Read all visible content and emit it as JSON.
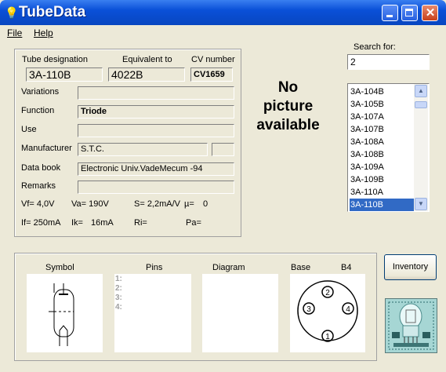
{
  "window": {
    "title": "TubeData",
    "icon": "lightbulb-icon"
  },
  "menu": {
    "file": "File",
    "help": "Help"
  },
  "header": {
    "tube_designation_label": "Tube designation",
    "tube_designation_value": "3A-110B",
    "equivalent_label": "Equivalent to",
    "equivalent_value": "4022B",
    "cv_label": "CV number",
    "cv_value": "CV1659"
  },
  "fields": {
    "variations_label": "Variations",
    "variations_value": "",
    "function_label": "Function",
    "function_value": "Triode",
    "use_label": "Use",
    "use_value": "",
    "manufacturer_label": "Manufacturer",
    "manufacturer_value": "S.T.C.",
    "manufacturer_code": "",
    "databook_label": "Data book",
    "databook_value": "Electronic Univ.VadeMecum -94",
    "remarks_label": "Remarks",
    "remarks_value": ""
  },
  "specs": {
    "vf": "Vf= 4,0V",
    "va": "Va= 190V",
    "s": "S= 2,2mA/V",
    "mu": "µ=",
    "mu_value": "0",
    "if": "If= 250mA",
    "ik": "Ik=",
    "ik_value": "16mA",
    "ri": "Ri=",
    "pa": "Pa="
  },
  "picture": {
    "line1": "No",
    "line2": "picture",
    "line3": "available"
  },
  "search": {
    "label": "Search for:",
    "value": "2"
  },
  "tube_list": {
    "items": [
      "3A-104B",
      "3A-105B",
      "3A-107A",
      "3A-107B",
      "3A-108A",
      "3A-108B",
      "3A-109A",
      "3A-109B",
      "3A-110A",
      "3A-110B"
    ],
    "selected": "3A-110B"
  },
  "bottom": {
    "symbol_label": "Symbol",
    "pins_label": "Pins",
    "pins": [
      "1:",
      "2:",
      "3:",
      "4:"
    ],
    "diagram_label": "Diagram",
    "base_label": "Base",
    "base_value": "B4",
    "base_pins": [
      "1",
      "2",
      "3",
      "4"
    ]
  },
  "buttons": {
    "inventory": "Inventory"
  }
}
